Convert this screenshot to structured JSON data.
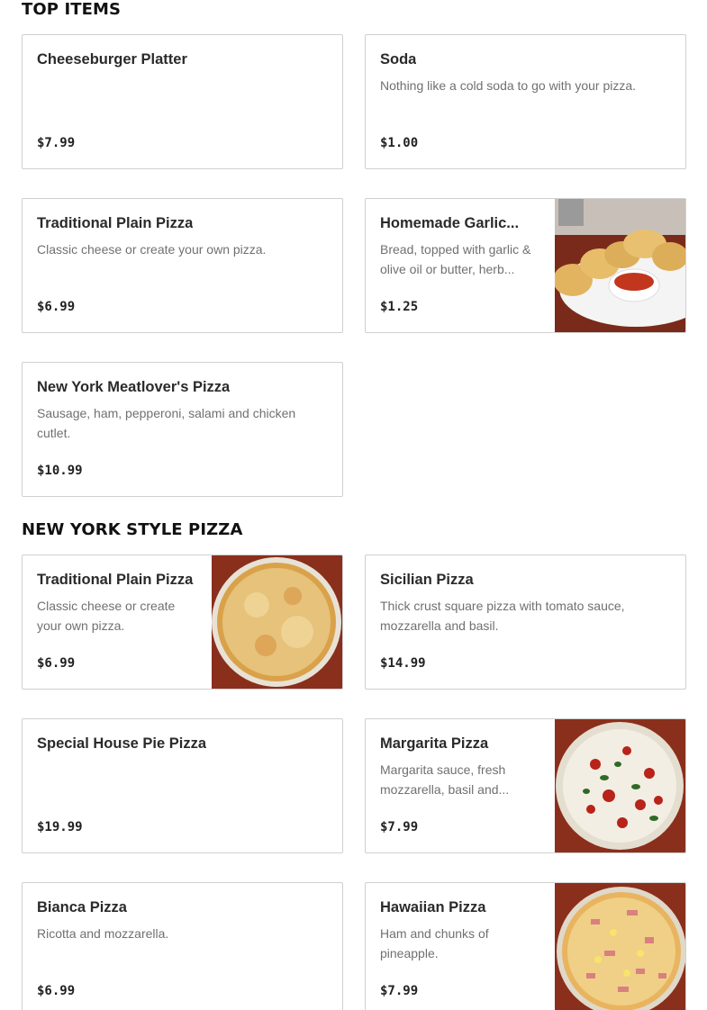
{
  "sections": {
    "top_items": {
      "title": "TOP ITEMS"
    },
    "ny_style": {
      "title": "NEW YORK STYLE PIZZA"
    }
  },
  "items": {
    "cheeseburger": {
      "name": "Cheeseburger Platter",
      "description": "",
      "price": "$7.99"
    },
    "soda": {
      "name": "Soda",
      "description": "Nothing like a cold soda to go with your pizza.",
      "price": "$1.00"
    },
    "plain_top": {
      "name": "Traditional Plain Pizza",
      "description": "Classic cheese or create your own pizza.",
      "price": "$6.99"
    },
    "garlic": {
      "name": "Homemade Garlic...",
      "description": "Bread, topped with garlic & olive oil or butter, herb...",
      "price": "$1.25",
      "image": "garlic-knots-image"
    },
    "meatlover": {
      "name": "New York Meatlover's Pizza",
      "description": "Sausage, ham, pepperoni, salami and chicken cutlet.",
      "price": "$10.99"
    },
    "plain_ny": {
      "name": "Traditional Plain Pizza",
      "description": "Classic cheese or create your own pizza.",
      "price": "$6.99",
      "image": "cheese-pizza-image"
    },
    "sicilian": {
      "name": "Sicilian Pizza",
      "description": "Thick crust square pizza with tomato sauce, mozzarella and basil.",
      "price": "$14.99"
    },
    "house_pie": {
      "name": "Special House Pie Pizza",
      "description": "",
      "price": "$19.99"
    },
    "margarita": {
      "name": "Margarita Pizza",
      "description": "Margarita sauce, fresh mozzarella, basil and...",
      "price": "$7.99",
      "image": "margarita-pizza-image"
    },
    "bianca": {
      "name": "Bianca Pizza",
      "description": "Ricotta and mozzarella.",
      "price": "$6.99"
    },
    "hawaiian": {
      "name": "Hawaiian Pizza",
      "description": "Ham and chunks of pineapple.",
      "price": "$7.99",
      "image": "hawaiian-pizza-image"
    }
  },
  "colors": {
    "border": "#d0d0d0",
    "description": "#707070",
    "wood": "#8a2f1c"
  }
}
